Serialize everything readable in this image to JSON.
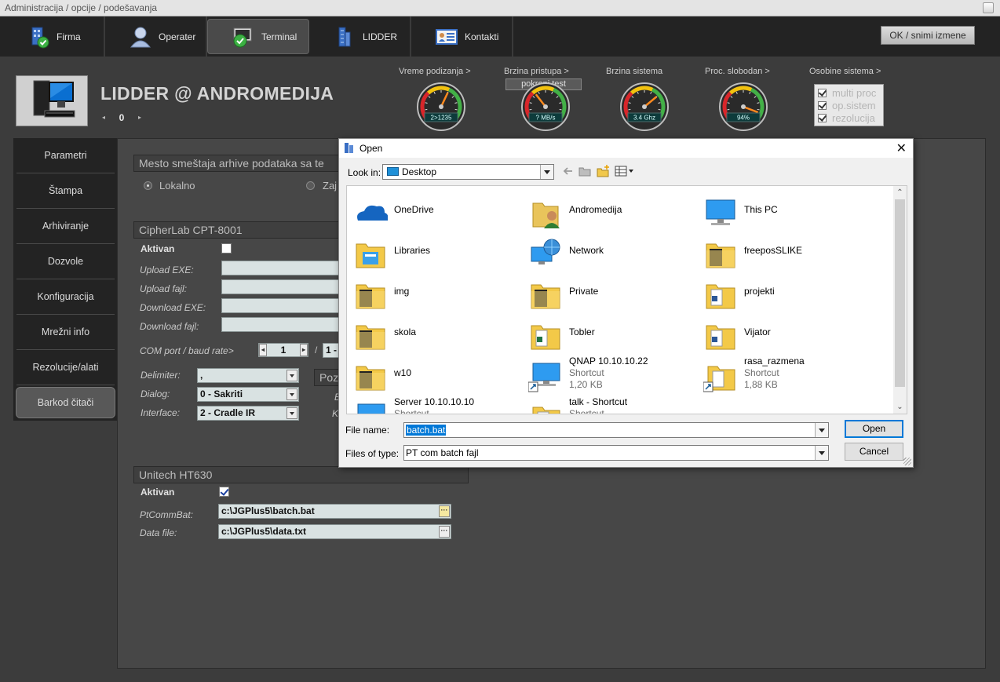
{
  "window": {
    "title": "Administracija / opcije / podešavanja"
  },
  "topnav": {
    "tabs": [
      {
        "label": "Firma",
        "icon": "building-check-icon"
      },
      {
        "label": "Operater",
        "icon": "user-icon"
      },
      {
        "label": "Terminal",
        "icon": "terminal-check-icon",
        "active": true
      },
      {
        "label": "LIDDER",
        "icon": "tower-icon"
      },
      {
        "label": "Kontakti",
        "icon": "contact-card-icon"
      }
    ],
    "ok_label": "OK / snimi izmene"
  },
  "header": {
    "title": "LIDDER @ ANDROMEDIJA",
    "counter_value": "0",
    "gauges": [
      {
        "label": "Vreme podizanja >",
        "readout": "2>1235",
        "level": 0.6
      },
      {
        "label": "Brzina pristupa >",
        "readout": "? MB/s",
        "level": 0.35
      },
      {
        "label": "Brzina sistema",
        "readout": "3.4 Ghz",
        "level": 0.7
      },
      {
        "label": "Proc. slobodan >",
        "readout": "94%",
        "level": 0.94
      }
    ],
    "test_button": "pokreni test",
    "sysprops": {
      "label": "Osobine sistema >",
      "items": [
        "multi proc",
        "op.sistem",
        "rezolucija"
      ]
    }
  },
  "sidemenu": {
    "items": [
      "Parametri",
      "Štampa",
      "Arhiviranje",
      "Dozvole",
      "Konfiguracija",
      "Mrežni info",
      "Rezolucije/alati",
      "Barkod čitači"
    ],
    "active_index": 7
  },
  "content": {
    "archive": {
      "title": "Mesto smeštaja arhive podataka sa te",
      "local": "Lokalno",
      "shared": "Zaj"
    },
    "cipherlab": {
      "title": "CipherLab CPT-8001",
      "aktivan": "Aktivan",
      "upload_exe": "Upload EXE:",
      "upload_file": "Upload fajl:",
      "download_exe": "Download EXE:",
      "download_file": "Download fajl:",
      "com_port": "COM port / baud rate>",
      "com_value": "1",
      "slash": "/",
      "baud_partial": "1 - ",
      "delimiter_label": "Delimiter:",
      "delimiter_value": ",",
      "dialog_label": "Dialog:",
      "dialog_value": "0 - Sakriti",
      "interface_label": "Interface:",
      "interface_value": "2 - Cradle IR",
      "poz_partial": "Pozi",
      "b_partial": "B",
      "k_partial": "K"
    },
    "unitech": {
      "title": "Unitech HT630",
      "aktivan": "Aktivan",
      "ptcomm_label": "PtCommBat:",
      "ptcomm_value": "c:\\JGPlus5\\batch.bat",
      "datafile_label": "Data file:",
      "datafile_value": "c:\\JGPlus5\\data.txt"
    }
  },
  "dialog": {
    "title": "Open",
    "look_in_label": "Look in:",
    "look_in_value": "Desktop",
    "items": [
      {
        "name": "OneDrive",
        "icon": "onedrive-cloud-icon"
      },
      {
        "name": "Andromedija",
        "icon": "user-folder-icon"
      },
      {
        "name": "This PC",
        "icon": "computer-icon"
      },
      {
        "name": "Libraries",
        "icon": "libraries-folder-icon"
      },
      {
        "name": "Network",
        "icon": "network-globe-icon"
      },
      {
        "name": "freeposSLIKE",
        "icon": "folder-icon"
      },
      {
        "name": "img",
        "icon": "folder-icon"
      },
      {
        "name": "Private",
        "icon": "folder-icon"
      },
      {
        "name": "projekti",
        "icon": "folder-doc-icon"
      },
      {
        "name": "skola",
        "icon": "folder-icon"
      },
      {
        "name": "Tobler",
        "icon": "folder-sheet-icon"
      },
      {
        "name": "Vijator",
        "icon": "folder-doc-icon"
      },
      {
        "name": "w10",
        "icon": "folder-icon"
      },
      {
        "name": "QNAP 10.10.10.22",
        "icon": "network-shortcut-icon",
        "sub1": "Shortcut",
        "sub2": "1,20 KB"
      },
      {
        "name": "rasa_razmena",
        "icon": "folder-shortcut-icon",
        "sub1": "Shortcut",
        "sub2": "1,88 KB"
      },
      {
        "name": "Server 10.10.10.10",
        "icon": "network-shortcut-icon",
        "sub1": "Shortcut"
      },
      {
        "name": "talk - Shortcut",
        "icon": "folder-shortcut-icon",
        "sub1": "Shortcut"
      }
    ],
    "file_name_label": "File name:",
    "file_name_value": "batch.bat",
    "file_type_label": "Files of type:",
    "file_type_value": "PT com batch fajl",
    "open_label": "Open",
    "cancel_label": "Cancel"
  }
}
